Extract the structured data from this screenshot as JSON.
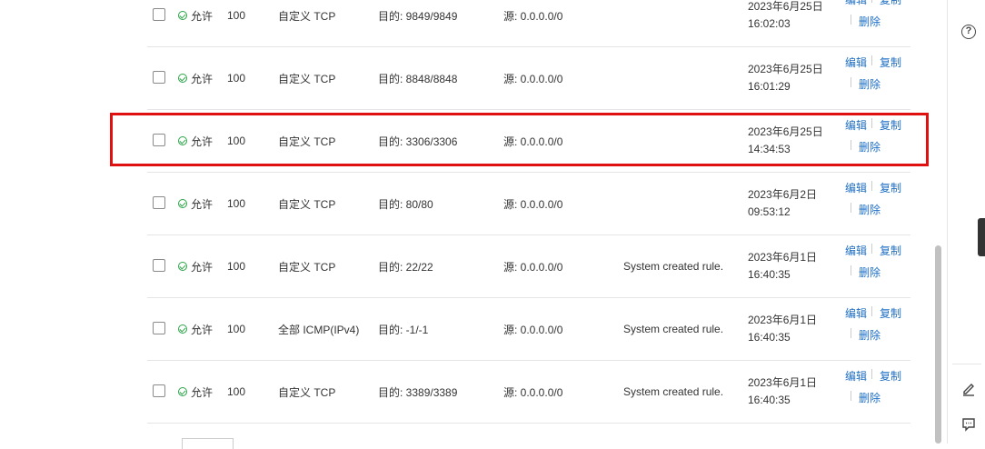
{
  "rules": [
    {
      "status": "允许",
      "priority": "100",
      "protocol": "自定义 TCP",
      "dest": "目的: 9849/9849",
      "src": "源: 0.0.0.0/0",
      "desc": "",
      "date": "2023年6月25日",
      "time": "16:02:03"
    },
    {
      "status": "允许",
      "priority": "100",
      "protocol": "自定义 TCP",
      "dest": "目的: 8848/8848",
      "src": "源: 0.0.0.0/0",
      "desc": "",
      "date": "2023年6月25日",
      "time": "16:01:29"
    },
    {
      "status": "允许",
      "priority": "100",
      "protocol": "自定义 TCP",
      "dest": "目的: 3306/3306",
      "src": "源: 0.0.0.0/0",
      "desc": "",
      "date": "2023年6月25日",
      "time": "14:34:53"
    },
    {
      "status": "允许",
      "priority": "100",
      "protocol": "自定义 TCP",
      "dest": "目的: 80/80",
      "src": "源: 0.0.0.0/0",
      "desc": "",
      "date": "2023年6月2日",
      "time": "09:53:12"
    },
    {
      "status": "允许",
      "priority": "100",
      "protocol": "自定义 TCP",
      "dest": "目的: 22/22",
      "src": "源: 0.0.0.0/0",
      "desc": "System created rule.",
      "date": "2023年6月1日",
      "time": "16:40:35"
    },
    {
      "status": "允许",
      "priority": "100",
      "protocol": "全部 ICMP(IPv4)",
      "dest": "目的: -1/-1",
      "src": "源: 0.0.0.0/0",
      "desc": "System created rule.",
      "date": "2023年6月1日",
      "time": "16:40:35"
    },
    {
      "status": "允许",
      "priority": "100",
      "protocol": "自定义 TCP",
      "dest": "目的: 3389/3389",
      "src": "源: 0.0.0.0/0",
      "desc": "System created rule.",
      "date": "2023年6月1日",
      "time": "16:40:35"
    }
  ],
  "actions": {
    "edit": "编辑",
    "copy": "复制",
    "delete": "删除"
  },
  "help_label": "?",
  "colors": {
    "link": "#1f6fc5",
    "allow": "#2aa347",
    "highlight": "#e01010"
  }
}
